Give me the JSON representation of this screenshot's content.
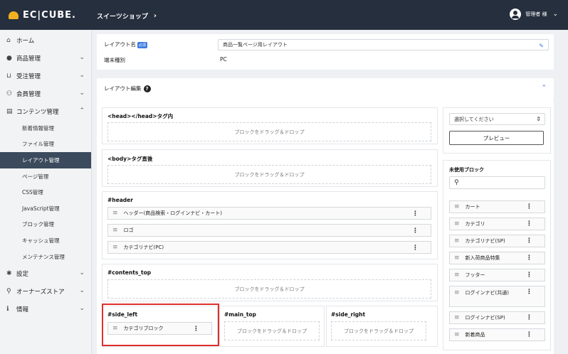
{
  "header": {
    "logo_text": "EC|CUBE.",
    "shop_name": "スイーツショップ",
    "shop_chevron": "›",
    "user_name": "管理者 様",
    "user_chevron": "⌄"
  },
  "sidebar": {
    "items": [
      {
        "icon": "⌂",
        "label": "ホーム"
      },
      {
        "icon": "●",
        "label": "商品管理",
        "arrow": "⌄"
      },
      {
        "icon": "⊔",
        "label": "受注管理",
        "arrow": "⌄"
      },
      {
        "icon": "⚇",
        "label": "会員管理",
        "arrow": "⌄"
      },
      {
        "icon": "▤",
        "label": "コンテンツ管理",
        "arrow": "⌃"
      }
    ],
    "subitems": [
      "新着情報管理",
      "ファイル管理",
      "レイアウト管理",
      "ページ管理",
      "CSS管理",
      "JavaScript管理",
      "ブロック管理",
      "キャッシュ管理",
      "メンテナンス管理"
    ],
    "bottom_items": [
      {
        "icon": "✱",
        "label": "設定",
        "arrow": "⌄"
      },
      {
        "icon": "⚲",
        "label": "オーナーズストア",
        "arrow": "⌄"
      },
      {
        "icon": "ℹ",
        "label": "情報",
        "arrow": "⌄"
      }
    ]
  },
  "layout_form": {
    "name_label": "レイアウト名",
    "required_badge": "必須",
    "name_value": "商品一覧ページ用レイアウト",
    "device_label": "端末種別",
    "device_value": "PC"
  },
  "layout_edit": {
    "title": "レイアウト編集",
    "help_icon": "?",
    "collapse_icon": "⌃"
  },
  "drop_text": "ブロックをドラッグ＆ドロップ",
  "zones": {
    "head": "<head></head>タグ内",
    "body_after": "<body>タグ直後",
    "header": "#header",
    "contents_top": "#contents_top",
    "side_left": "#side_left",
    "main_top": "#main_top",
    "side_right": "#side_right"
  },
  "header_blocks": [
    "ヘッダー(商品検索・ログインナビ・カート)",
    "ロゴ",
    "カテゴリナビ(PC)"
  ],
  "side_left_blocks": [
    "カテゴリブロック"
  ],
  "preview": {
    "select_placeholder": "選択してください",
    "select_arrow": "⇕",
    "button_label": "プレビュー"
  },
  "unused": {
    "title": "未使用ブロック",
    "search_icon": "⚲",
    "blocks": [
      "カート",
      "カテゴリ",
      "カテゴリナビ(SP)",
      "新入荷商品特集",
      "フッター",
      "ログインナビ(共通)",
      "ログインナビ(SP)",
      "新着商品"
    ]
  },
  "icons": {
    "handle": "≡",
    "kebab": "⋮"
  },
  "colors": {
    "topbar": "#262f3e",
    "active_nav": "#3b4a5c",
    "highlight": "#e0302d",
    "required": "#3d7be0"
  }
}
